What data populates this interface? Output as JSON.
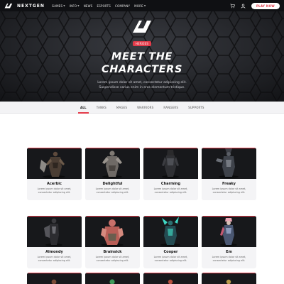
{
  "header": {
    "brand": "NEXTGEN",
    "nav": [
      {
        "label": "GAMES",
        "dropdown": true
      },
      {
        "label": "INFO",
        "dropdown": true
      },
      {
        "label": "NEWS",
        "dropdown": false
      },
      {
        "label": "ESPORTS",
        "dropdown": false
      },
      {
        "label": "COMPANY",
        "dropdown": false
      },
      {
        "label": "MORE",
        "dropdown": true
      }
    ],
    "icons": [
      "cart-icon",
      "user-icon"
    ],
    "play_label": "PLAY NOW"
  },
  "hero": {
    "tag": "HEROES",
    "title_line1": "MEET THE",
    "title_line2": "CHARACTERS",
    "text_line1": "Lorem ipsum dolor sit amet, consectetur adipiscing elit.",
    "text_line2": "Suspendisse varius enim in eros elementum tristique."
  },
  "tabs": [
    {
      "label": "ALL",
      "active": true
    },
    {
      "label": "TANKS",
      "active": false
    },
    {
      "label": "MAGES",
      "active": false
    },
    {
      "label": "WARRIORS",
      "active": false
    },
    {
      "label": "RANGERS",
      "active": false
    },
    {
      "label": "SUPPORTS",
      "active": false
    }
  ],
  "characters": [
    {
      "name": "Acerbic",
      "desc_line1": "Lorem ipsum dolor sit amet,",
      "desc_line2": "consectetur adipiscing elit."
    },
    {
      "name": "Delightful",
      "desc_line1": "Lorem ipsum dolor sit amet,",
      "desc_line2": "consectetur adipiscing elit."
    },
    {
      "name": "Charming",
      "desc_line1": "Lorem ipsum dolor sit amet,",
      "desc_line2": "consectetur adipiscing elit."
    },
    {
      "name": "Freaky",
      "desc_line1": "Lorem ipsum dolor sit amet,",
      "desc_line2": "consectetur adipiscing elit."
    },
    {
      "name": "Almondy",
      "desc_line1": "Lorem ipsum dolor sit amet,",
      "desc_line2": "consectetur adipiscing elit."
    },
    {
      "name": "Brainsick",
      "desc_line1": "Lorem ipsum dolor sit amet,",
      "desc_line2": "consectetur adipiscing elit."
    },
    {
      "name": "Cooper",
      "desc_line1": "Lorem ipsum dolor sit amet,",
      "desc_line2": "consectetur adipiscing elit."
    },
    {
      "name": "Em",
      "desc_line1": "Lorem ipsum dolor sit amet,",
      "desc_line2": "consectetur adipiscing elit."
    }
  ],
  "colors": {
    "accent": "#e33b4a",
    "dark": "#0f1013",
    "hero_bg": "#2a2c31",
    "card_bg": "#f4f4f6"
  }
}
